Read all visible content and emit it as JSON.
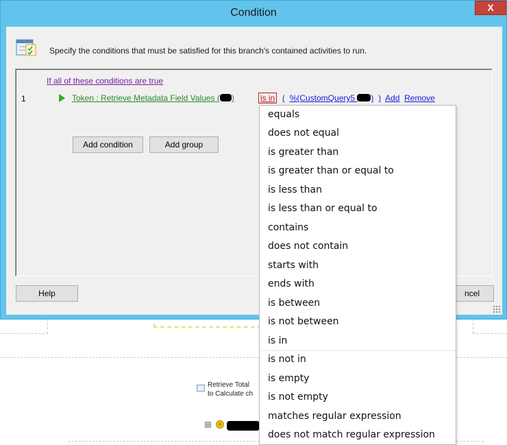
{
  "window": {
    "title": "Condition",
    "close_label": "X"
  },
  "instruction": "Specify the conditions that must be satisfied for this branch's contained activities to run.",
  "conditions": {
    "group_link": "If all of these conditions are true",
    "row_number": "1",
    "token_text": "Token : Retrieve Metadata Field Values (",
    "token_close": ")",
    "operator": "is in",
    "open_paren": "(",
    "value_text": "%(CustomQuery5",
    "value_close": ")",
    "close_paren": ")",
    "add_link": "Add",
    "remove_link": "Remove"
  },
  "buttons": {
    "add_condition": "Add condition",
    "add_group": "Add group",
    "help": "Help",
    "cancel_partial": "ncel"
  },
  "dropdown": {
    "items": [
      "equals",
      "does not equal",
      "is greater than",
      "is greater than or equal to",
      "is less than",
      "is less than or equal to",
      "contains",
      "does not contain",
      "starts with",
      "ends with",
      "is between",
      "is not between",
      "is in",
      "is not in",
      "is empty",
      "is not empty",
      "matches regular expression",
      "does not match regular expression"
    ]
  },
  "background": {
    "activity_label_1": "Retrieve Total",
    "activity_label_2": "to Calculate ch",
    "expand_symbol": "⊟",
    "gold_symbol": "+"
  },
  "colors": {
    "titlebar": "#62c3ec",
    "close": "#c7433a",
    "operator": "#c02020",
    "token": "#2a8a2a",
    "link": "#1a1ae0"
  }
}
